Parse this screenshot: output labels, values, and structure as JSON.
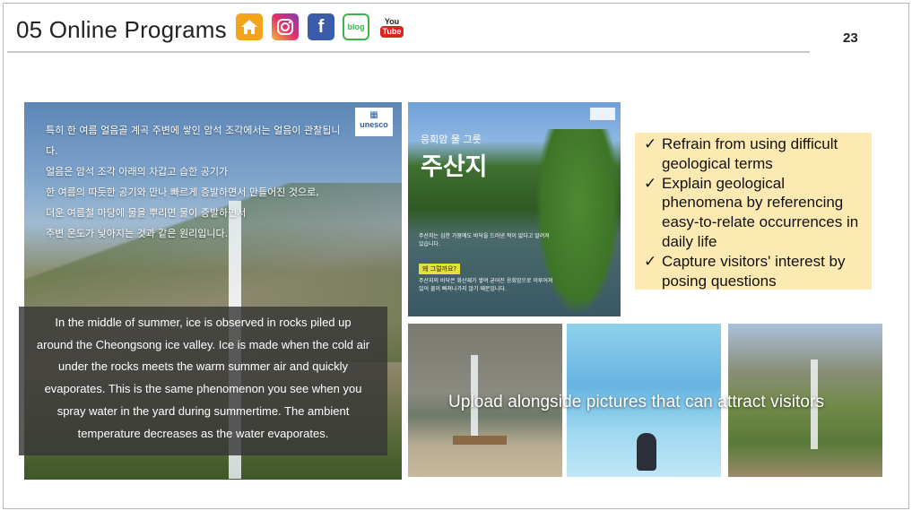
{
  "header": {
    "title": "05 Online Programs",
    "page_number": "23"
  },
  "social_icons": [
    {
      "name": "home-icon"
    },
    {
      "name": "instagram-icon"
    },
    {
      "name": "facebook-icon",
      "glyph": "f"
    },
    {
      "name": "blog-icon",
      "text": "blog"
    },
    {
      "name": "youtube-icon",
      "text_top": "You",
      "text_bottom": "Tube"
    }
  ],
  "left_photo": {
    "logo_text": "unesco",
    "korean_lines": [
      "특히 한 여름 얼음골 계곡 주변에 쌓인 암석 조각에서는 얼음이 관찰됩니다.",
      "얼음은 암석 조각 아래의 차갑고 습한 공기가",
      "한 여름의 따듯한 공기와 만나 빠르게 증발하면서 만들어진 것으로,",
      "더운 여름철 마당에 물을 뿌리면 물이 증발하면서",
      "주변 온도가 낮아지는 것과 같은 원리입니다."
    ],
    "caption": [
      "In the middle of summer, ice is observed in rocks piled up",
      "around the Cheongsong ice valley. Ice is made when the cold air",
      "under the rocks meets the warm summer air and quickly",
      "evaporates. This is the same phenomenon you see when you",
      "spray water in the yard during summertime. The ambient",
      "temperature decreases as the water evaporates."
    ]
  },
  "top_photo": {
    "small_title": "응회암 물 그릇",
    "big_title": "주산지",
    "para1": "주산지는 심한 가뭄에도 바닥을 드러낸 적이 없다고 알려져 있습니다.",
    "tag": "왜 그럴까요?",
    "para2": "주산지의 바닥은 화산재가 쌓여 굳어진 응회암으로 이루어져 있어 물이 빠져나가지 않기 때문입니다."
  },
  "tips": [
    "Refrain from using difficult geological terms",
    "Explain geological phenomena by referencing easy-to-relate occurrences in daily life",
    "Capture visitors' interest by posing questions"
  ],
  "tip_check_glyph": "✓",
  "bottom_photos": {
    "overlay_text": "Upload alongside pictures that can attract visitors"
  },
  "colors": {
    "tips_background": "#fdeab3",
    "caption_background": "#373737",
    "home_icon": "#f2a41a",
    "facebook_icon": "#3b5ca8",
    "blog_icon": "#3bb44a",
    "youtube_icon": "#d9251d"
  }
}
